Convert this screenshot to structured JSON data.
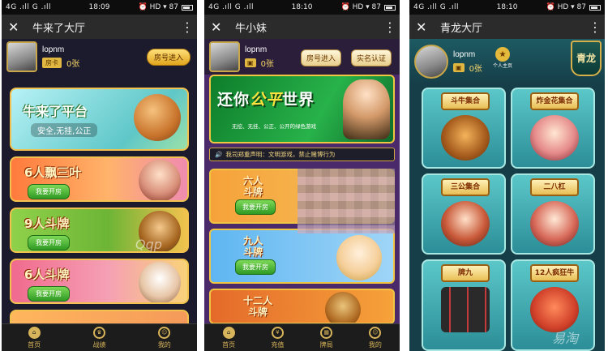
{
  "screens": [
    {
      "status": {
        "carrier": "4G .ıll G .ıll",
        "time": "18:09",
        "right": "⏰ HD ▾ 87"
      },
      "title": "牛来了大厅",
      "user": {
        "name": "lopnm",
        "card_label": "房卡",
        "count": "0张",
        "join_button": "房号进入"
      },
      "banner": {
        "title": "牛来了平台",
        "subtitle": "安全,无挂,公正"
      },
      "games": [
        {
          "name": "6人飘三叶",
          "button": "我要开房"
        },
        {
          "name": "9人斗牌",
          "button": "我要开房"
        },
        {
          "name": "6人斗牌",
          "button": "我要开房"
        }
      ],
      "nav": [
        {
          "label": "首页",
          "icon": "home-icon",
          "glyph": "⌂"
        },
        {
          "label": "战绩",
          "icon": "record-icon",
          "glyph": "♛"
        },
        {
          "label": "我的",
          "icon": "profile-icon",
          "glyph": "☺"
        }
      ],
      "watermark": "Qqp"
    },
    {
      "status": {
        "carrier": "4G .ıll G .ıll",
        "time": "18:10",
        "right": "⏰ HD ▾ 87"
      },
      "title": "牛小妹",
      "user": {
        "name": "lopnm",
        "count": "0张",
        "join_button": "房号进入",
        "verify_button": "实名认证"
      },
      "banner": {
        "title_a": "还你",
        "title_b": "公平",
        "title_c": "世界",
        "subtitle": "无挖、无挂、公正、公开的绿色游戏"
      },
      "notice": "我司郑重声明：文明游戏，禁止赌博行为",
      "games": [
        {
          "name": "六人\n斗牌",
          "button": "我要开房"
        },
        {
          "name": "九人\n斗牌",
          "button": "我要开房"
        },
        {
          "name": "十二人\n斗牌",
          "button": ""
        }
      ],
      "nav": [
        {
          "label": "首页",
          "icon": "home-icon",
          "glyph": "⌂"
        },
        {
          "label": "充值",
          "icon": "recharge-icon",
          "glyph": "¥"
        },
        {
          "label": "牌局",
          "icon": "cards-icon",
          "glyph": "▦"
        },
        {
          "label": "我的",
          "icon": "profile-icon",
          "glyph": "☺"
        }
      ]
    },
    {
      "status": {
        "carrier": "4G .ıll G .ıll",
        "time": "18:10",
        "right": "⏰ HD ▾ 87"
      },
      "title": "青龙大厅",
      "user": {
        "name": "lopnm",
        "count": "0张",
        "vip_label": "个人主页"
      },
      "crest": "青龙",
      "tiles": [
        {
          "name": "斗牛集合"
        },
        {
          "name": "炸金花集合"
        },
        {
          "name": "三公集合"
        },
        {
          "name": "二八杠"
        },
        {
          "name": "牌九"
        },
        {
          "name": "12人疯狂牛"
        }
      ],
      "watermark": "易淘"
    }
  ]
}
